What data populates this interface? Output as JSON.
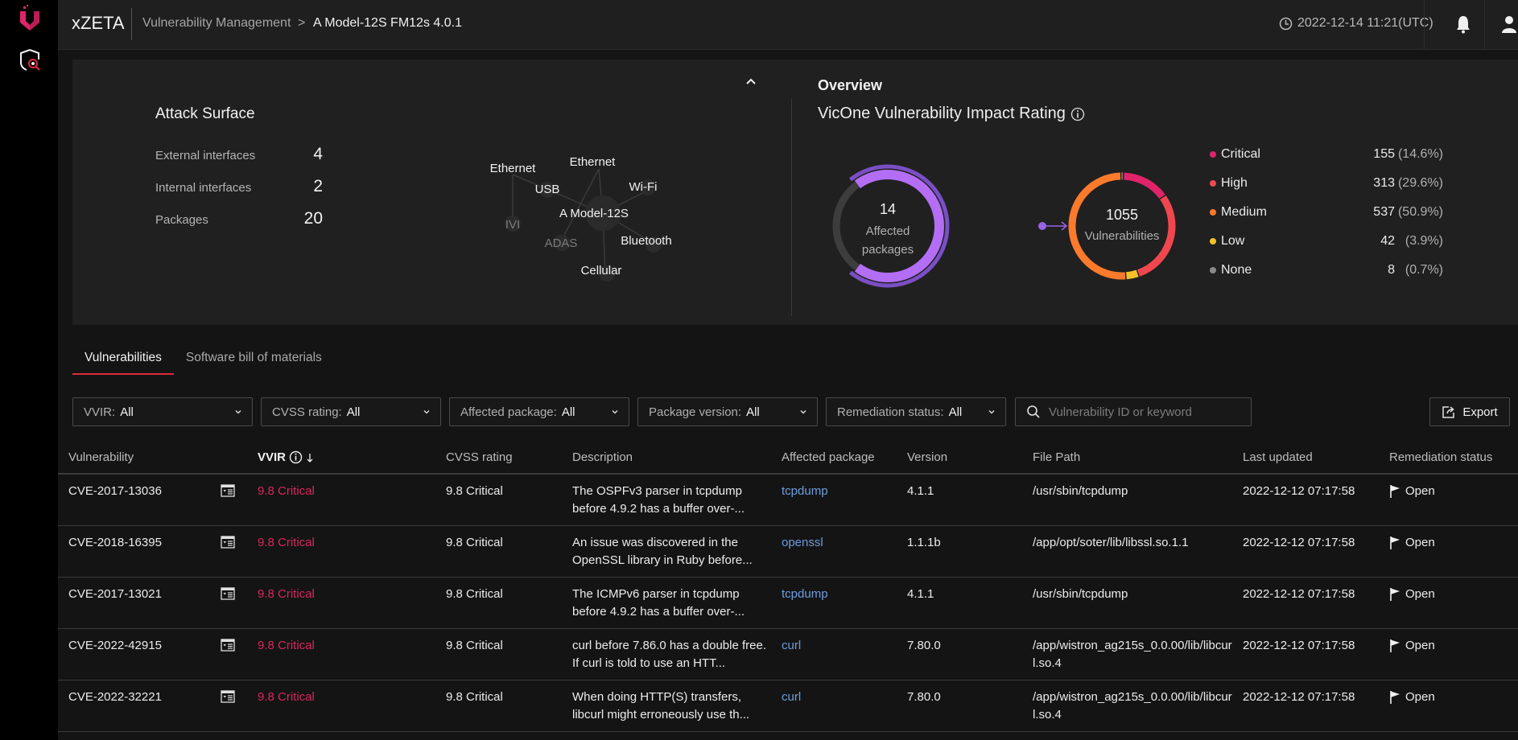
{
  "header": {
    "app_name": "xZETA",
    "breadcrumb": [
      "Vulnerability Management",
      "A Model-12S FM12s 4.0.1"
    ],
    "breadcrumb_separator": ">",
    "timestamp": "2022-12-14 11:21(UTC)"
  },
  "sidebar": {
    "items": [
      {
        "name": "logo",
        "icon": "vicone-logo-icon"
      },
      {
        "name": "vulnerability-management",
        "icon": "shield-search-icon"
      }
    ]
  },
  "attack_surface": {
    "title": "Attack Surface",
    "rows": [
      {
        "label": "External interfaces",
        "value": "4"
      },
      {
        "label": "Internal interfaces",
        "value": "2"
      },
      {
        "label": "Packages",
        "value": "20"
      }
    ],
    "graph": {
      "center": "A Model-12S",
      "nodes": [
        {
          "label": "Ethernet",
          "type": "external"
        },
        {
          "label": "Ethernet",
          "type": "external"
        },
        {
          "label": "USB",
          "type": "external"
        },
        {
          "label": "Wi-Fi",
          "type": "external"
        },
        {
          "label": "Bluetooth",
          "type": "external"
        },
        {
          "label": "Cellular",
          "type": "external"
        },
        {
          "label": "IVI",
          "type": "internal"
        },
        {
          "label": "ADAS",
          "type": "internal"
        }
      ]
    }
  },
  "overview": {
    "title": "Overview",
    "vvir_title": "VicOne Vulnerability Impact Rating",
    "affected_packages": {
      "count": "14",
      "label": "Affected packages",
      "total_packages": 20
    },
    "vulnerabilities": {
      "count": "1055",
      "label": "Vulnerabilities"
    },
    "legend": [
      {
        "name": "Critical",
        "count": "155",
        "pct": "(14.6%)",
        "value": 155,
        "color": "#e0246a"
      },
      {
        "name": "High",
        "count": "313",
        "pct": "(29.6%)",
        "value": 313,
        "color": "#f0474f"
      },
      {
        "name": "Medium",
        "count": "537",
        "pct": "(50.9%)",
        "value": 537,
        "color": "#fb7a2c"
      },
      {
        "name": "Low",
        "count": "42",
        "pct": "(3.9%)",
        "value": 42,
        "color": "#f5c125"
      },
      {
        "name": "None",
        "count": "8",
        "pct": "(0.7%)",
        "value": 8,
        "color": "#8a8a8a"
      }
    ]
  },
  "tabs": [
    {
      "label": "Vulnerabilities",
      "active": true
    },
    {
      "label": "Software bill of materials",
      "active": false
    }
  ],
  "filters": [
    {
      "label": "VVIR:",
      "value": "All"
    },
    {
      "label": "CVSS rating:",
      "value": "All"
    },
    {
      "label": "Affected package:",
      "value": "All"
    },
    {
      "label": "Package version:",
      "value": "All"
    },
    {
      "label": "Remediation status:",
      "value": "All"
    }
  ],
  "search": {
    "placeholder": "Vulnerability ID or keyword",
    "value": ""
  },
  "export_label": "Export",
  "table": {
    "columns": [
      "Vulnerability",
      "VVIR",
      "CVSS rating",
      "Description",
      "Affected package",
      "Version",
      "File Path",
      "Last updated",
      "Remediation status"
    ],
    "sort": {
      "column": "VVIR",
      "direction": "descending"
    },
    "rows": [
      {
        "id": "CVE-2017-13036",
        "vvir": "9.8 Critical",
        "cvss": "9.8 Critical",
        "description": "The OSPFv3 parser in tcpdump before 4.9.2 has a buffer over-...",
        "package": "tcpdump",
        "version": "4.1.1",
        "path": "/usr/sbin/tcpdump",
        "updated": "2022-12-12 07:17:58",
        "status": "Open"
      },
      {
        "id": "CVE-2018-16395",
        "vvir": "9.8 Critical",
        "cvss": "9.8 Critical",
        "description": "An issue was discovered in the OpenSSL library in Ruby before...",
        "package": "openssl",
        "version": "1.1.1b",
        "path": "/app/opt/soter/lib/libssl.so.1.1",
        "updated": "2022-12-12 07:17:58",
        "status": "Open"
      },
      {
        "id": "CVE-2017-13021",
        "vvir": "9.8 Critical",
        "cvss": "9.8 Critical",
        "description": "The ICMPv6 parser in tcpdump before 4.9.2 has a buffer over-...",
        "package": "tcpdump",
        "version": "4.1.1",
        "path": "/usr/sbin/tcpdump",
        "updated": "2022-12-12 07:17:58",
        "status": "Open"
      },
      {
        "id": "CVE-2022-42915",
        "vvir": "9.8 Critical",
        "cvss": "9.8 Critical",
        "description": "curl before 7.86.0 has a double free. If curl is told to use an HTT...",
        "package": "curl",
        "version": "7.80.0",
        "path": "/app/wistron_ag215s_0.0.00/lib/libcurl.so.4",
        "updated": "2022-12-12 07:17:58",
        "status": "Open"
      },
      {
        "id": "CVE-2022-32221",
        "vvir": "9.8 Critical",
        "cvss": "9.8 Critical",
        "description": "When doing HTTP(S) transfers, libcurl might erroneously use th...",
        "package": "curl",
        "version": "7.80.0",
        "path": "/app/wistron_ag215s_0.0.00/lib/libcurl.so.4",
        "updated": "2022-12-12 07:17:58",
        "status": "Open"
      }
    ]
  },
  "colors": {
    "accent_red": "#e02b3a",
    "critical_text": "#d9265c",
    "link": "#6d9de0",
    "affected_purple": "#b36ef5"
  }
}
